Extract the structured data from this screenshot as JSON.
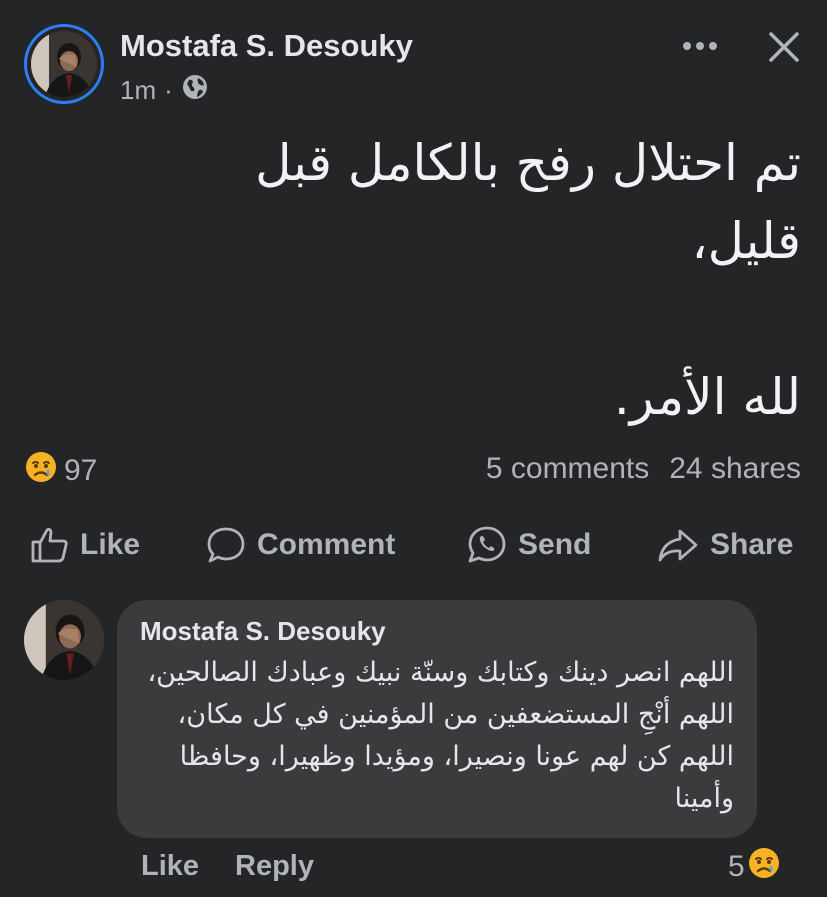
{
  "post": {
    "author": "Mostafa S. Desouky",
    "timestamp": "1m",
    "separator": "·",
    "privacy_icon": "globe-icon",
    "body_lines": [
      "تم احتلال رفح بالكامل قبل",
      "قليل،",
      "لله الأمر."
    ],
    "reaction_icon": "sad-emoji-icon",
    "reaction_count": "97",
    "comments_count": "5 comments",
    "shares_count": "24 shares"
  },
  "header": {
    "more_icon": "more-horizontal-icon",
    "close_icon": "close-icon"
  },
  "actions": {
    "like": "Like",
    "comment": "Comment",
    "send": "Send",
    "share": "Share"
  },
  "comment": {
    "author": "Mostafa S. Desouky",
    "text": "اللهم انصر دينك وكتابك وسنّة نبيك وعبادك الصالحين، اللهم أنْجِ المستضعفين من المؤمنين في كل مكان، اللهم كن لهم عونا ونصيرا، ومؤيدا وظهيرا، وحافظا وأمينا",
    "like_label": "Like",
    "reply_label": "Reply",
    "reaction_count": "5",
    "reaction_icon": "sad-emoji-icon"
  },
  "colors": {
    "background": "#242526",
    "bubble": "#3a3b3c",
    "text_primary": "#e4e6eb",
    "text_secondary": "#b0b3b8",
    "avatar_ring": "#2d7df6"
  }
}
